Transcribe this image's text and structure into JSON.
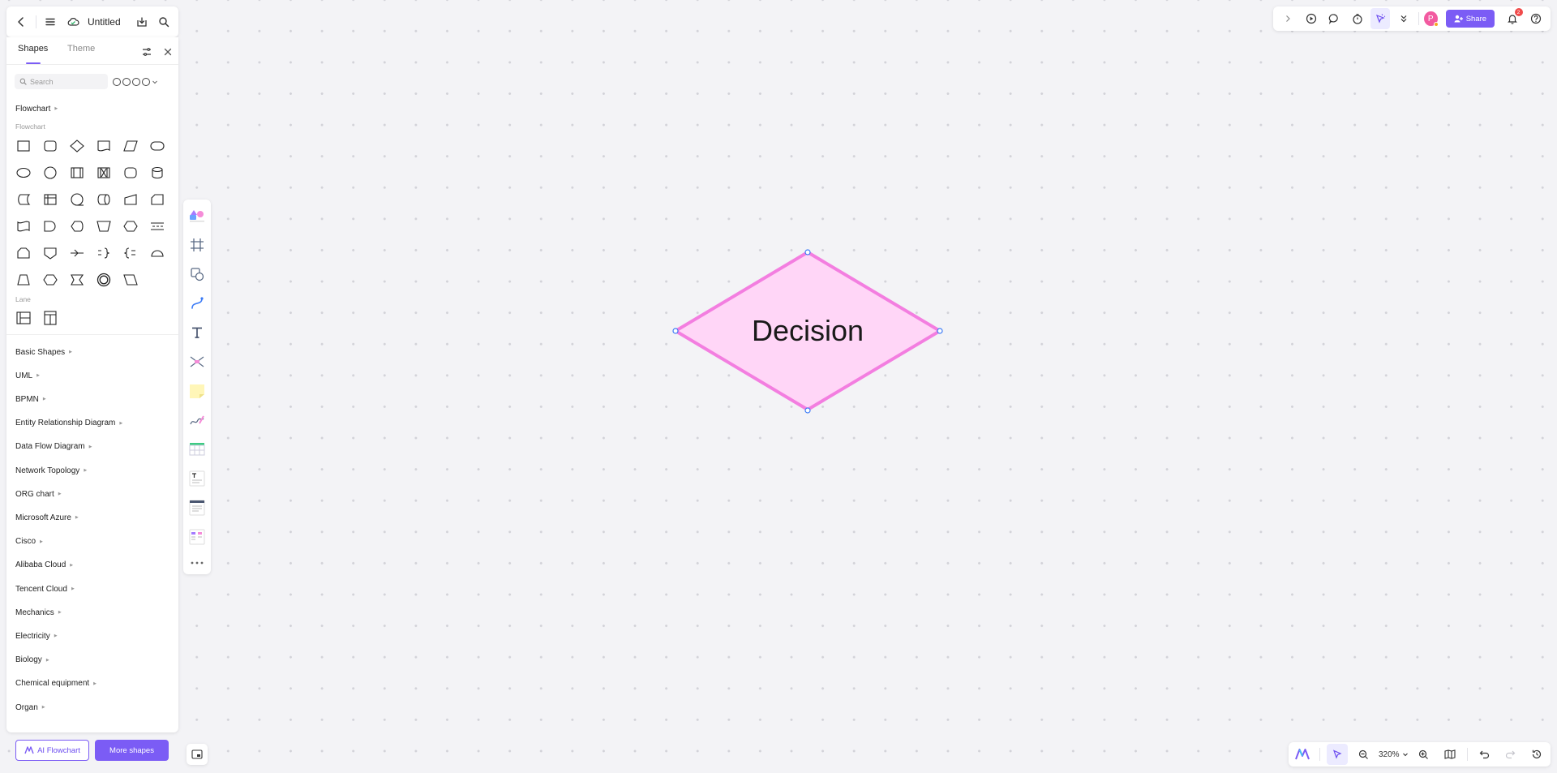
{
  "header": {
    "title": "Untitled"
  },
  "panel": {
    "tabs": {
      "shapes": "Shapes",
      "theme": "Theme"
    },
    "search_placeholder": "Search",
    "flowchart_section": {
      "title": "Flowchart",
      "sub_label": "Flowchart",
      "lane_label": "Lane"
    },
    "categories": [
      "Basic Shapes",
      "UML",
      "BPMN",
      "Entity Relationship Diagram",
      "Data Flow Diagram",
      "Network Topology",
      "ORG chart",
      "Microsoft Azure",
      "Cisco",
      "Alibaba Cloud",
      "Tencent Cloud",
      "Mechanics",
      "Electricity",
      "Biology",
      "Chemical equipment",
      "Organ"
    ],
    "ai_flowchart_label": "AI Flowchart",
    "more_shapes_label": "More shapes"
  },
  "topbar": {
    "share_label": "Share",
    "avatar_initial": "P",
    "notification_count": "2"
  },
  "canvas": {
    "shape_text": "Decision",
    "fill_color": "#ffd6f7",
    "stroke_color": "#f37ee0",
    "handle_color": "#3b7bf6"
  },
  "zoom": {
    "level": "320%"
  },
  "colors": {
    "accent": "#7b5cf5"
  }
}
